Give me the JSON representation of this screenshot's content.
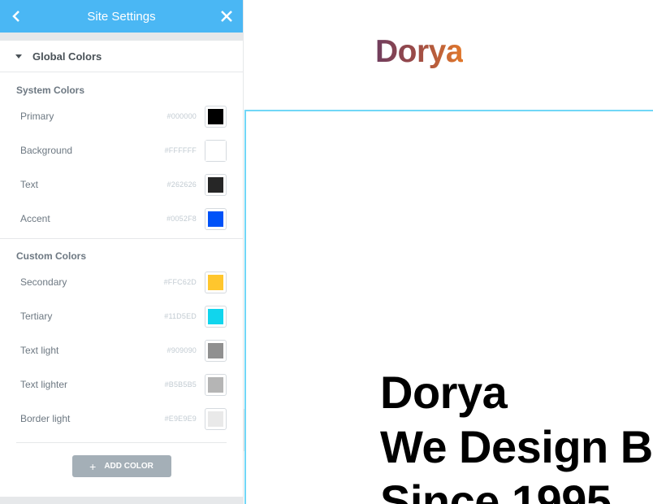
{
  "header": {
    "title": "Site Settings",
    "back_icon": "chevron-left-icon",
    "close_icon": "close-icon"
  },
  "global_colors": {
    "title": "Global Colors",
    "system": {
      "label": "System Colors",
      "items": [
        {
          "name": "Primary",
          "hex": "#000000",
          "color": "#000000"
        },
        {
          "name": "Background",
          "hex": "#FFFFFF",
          "color": "#FFFFFF"
        },
        {
          "name": "Text",
          "hex": "#262626",
          "color": "#262626"
        },
        {
          "name": "Accent",
          "hex": "#0052F8",
          "color": "#0052F8"
        }
      ]
    },
    "custom": {
      "label": "Custom Colors",
      "items": [
        {
          "name": "Secondary",
          "hex": "#FFC62D",
          "color": "#FFC62D"
        },
        {
          "name": "Tertiary",
          "hex": "#11D5ED",
          "color": "#11D5ED"
        },
        {
          "name": "Text light",
          "hex": "#909090",
          "color": "#909090"
        },
        {
          "name": "Text lighter",
          "hex": "#B5B5B5",
          "color": "#B5B5B5"
        },
        {
          "name": "Border light",
          "hex": "#E9E9E9",
          "color": "#E9E9E9"
        }
      ]
    },
    "add_button": "ADD COLOR"
  },
  "preview": {
    "logo": "Dorya",
    "hero_lines": [
      "Dorya",
      "We Design B",
      "Since 1995"
    ]
  }
}
